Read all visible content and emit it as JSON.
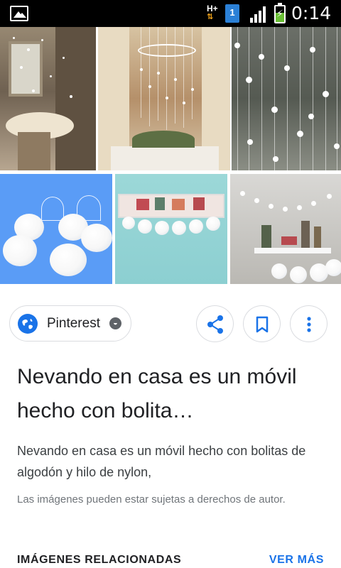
{
  "status_bar": {
    "network": "H+",
    "sim_slot": "1",
    "time": "0:14",
    "icons": [
      "image-notification-icon",
      "network-arrows-icon",
      "sim-icon",
      "signal-icon",
      "battery-charging-icon"
    ]
  },
  "image_grid": {
    "images": [
      "snowy-dining-room-photo",
      "snowball-mobile-photo",
      "snowball-strands-photo",
      "cotton-balls-photo",
      "snowball-garland-photo",
      "snowball-shelf-photo"
    ]
  },
  "source": {
    "name": "Pinterest",
    "icon": "globe-icon",
    "verified_icon": "compass-icon"
  },
  "actions": {
    "share_icon": "share-icon",
    "save_icon": "bookmark-icon",
    "more_icon": "more-vertical-icon"
  },
  "result": {
    "title": "Nevando en casa es un móvil hecho con bolita…",
    "description": "Nevando en casa es un móvil hecho con bolitas de algodón y hilo de nylon,",
    "copyright": "Las imágenes pueden estar sujetas a derechos de autor."
  },
  "related": {
    "heading": "IMÁGENES RELACIONADAS",
    "more_label": "VER MÁS"
  },
  "colors": {
    "accent": "#1a73e8",
    "border": "#dadce0",
    "text": "#202124"
  }
}
